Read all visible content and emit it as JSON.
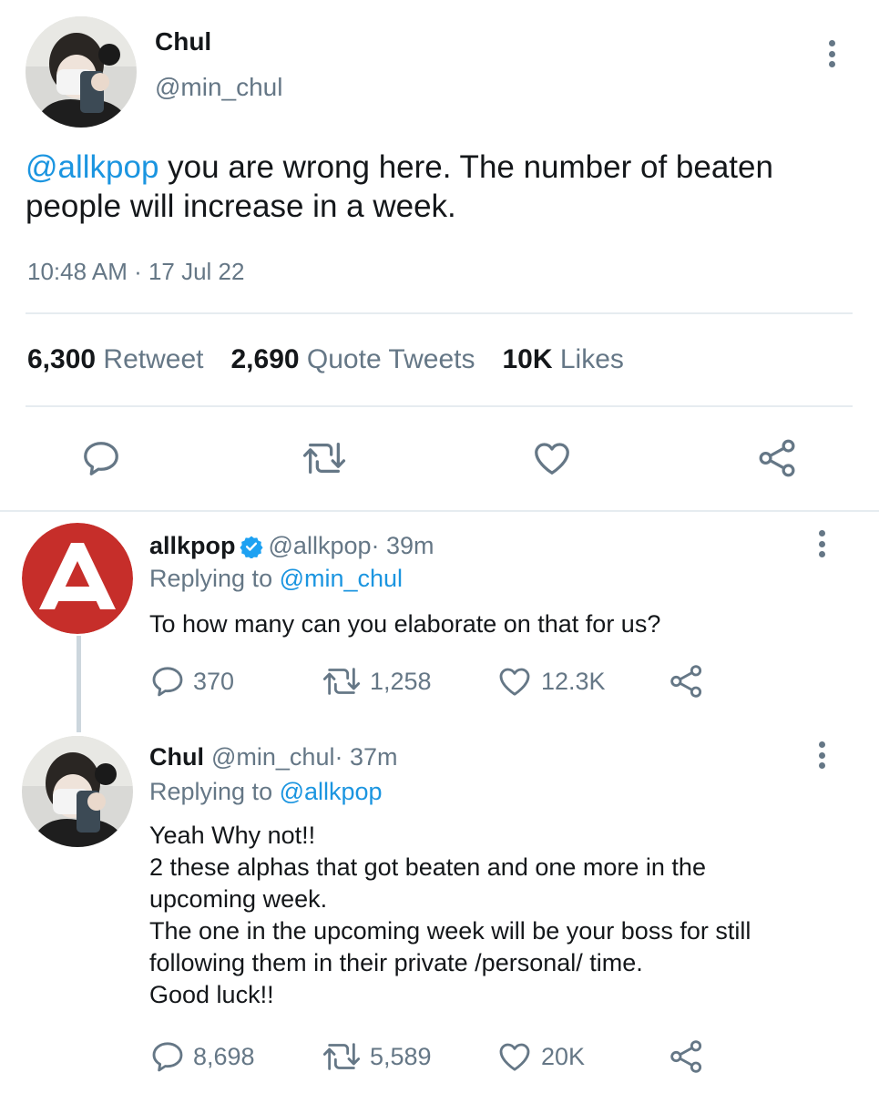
{
  "main_tweet": {
    "author_name": "Chul",
    "author_handle": "@min_chul",
    "mention": "@allkpop",
    "text": " you are wrong here. The number of beaten people will increase in a week.",
    "timestamp": "10:48 AM · 17 Jul 22",
    "stats": {
      "retweets": "6,300",
      "retweets_label": "Retweet",
      "quotes": "2,690",
      "quotes_label": "Quote Tweets",
      "likes": "10K",
      "likes_label": "Likes"
    }
  },
  "replies": [
    {
      "author_name": "allkpop",
      "verified": true,
      "author_handle": "@allkpop",
      "age": " · 39m",
      "replying_label": "Replying to ",
      "replying_to": "@min_chul",
      "text": "To how many can you elaborate on that for us?",
      "counts": {
        "replies": "370",
        "retweets": "1,258",
        "likes": "12.3K"
      }
    },
    {
      "author_name": "Chul",
      "author_handle": "@min_chul",
      "age": " · 37m",
      "replying_label": "Replying to ",
      "replying_to": "@allkpop",
      "text_lines": [
        "Yeah Why not!!",
        "2 these alphas that got beaten and one more in the",
        "upcoming week.",
        "The one in the upcoming week will be your boss for still",
        "following them in their private /personal/ time.",
        "Good luck!!"
      ],
      "counts": {
        "replies": "8,698",
        "retweets": "5,589",
        "likes": "20K"
      }
    }
  ],
  "colors": {
    "accent": "#1b95e0",
    "muted": "#657786",
    "divider": "#e6ecf0",
    "verified": "#1da1f2",
    "allkpop_red": "#c62e2a"
  },
  "icons": [
    "reply-icon",
    "retweet-icon",
    "like-icon",
    "share-icon",
    "more-options-icon",
    "verified-badge-icon"
  ]
}
